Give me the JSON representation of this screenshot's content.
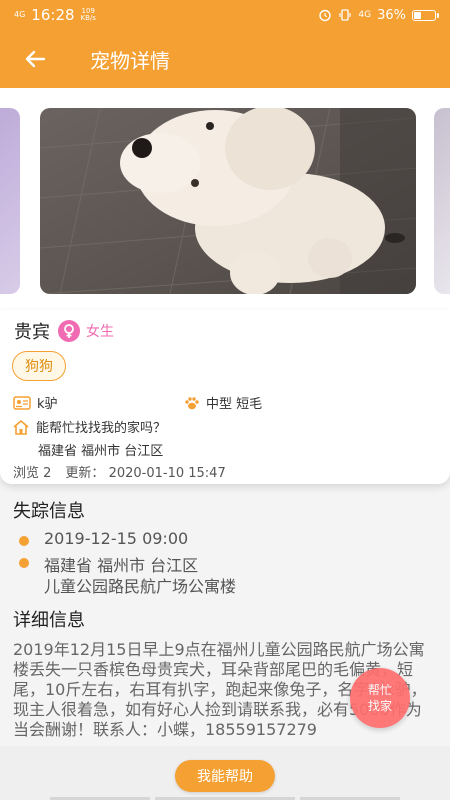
{
  "status_bar": {
    "signal": "4G",
    "time": "16:28",
    "net_speed_value": "109",
    "net_speed_unit": "KB/s",
    "network": "4G",
    "battery": "36%",
    "battery_level": 0.36
  },
  "header": {
    "back_icon": "arrow-left-icon",
    "title": "宠物详情"
  },
  "pet": {
    "name": "贵宾",
    "gender": "女生",
    "gender_icon": "female-icon",
    "category_tag": "狗狗",
    "size_label": "k驴",
    "coat_label": "中型 短毛",
    "prompt": "能帮忙找找我的家吗？",
    "region": "福建省 福州市 台江区",
    "views_label": "浏览 2",
    "updated_label": "更新：",
    "updated_time": "2020-01-10 15:47"
  },
  "lost_info": {
    "title": "失踪信息",
    "datetime": "2019-12-15 09:00",
    "region": "福建省 福州市 台江区",
    "address": "儿童公园路民航广场公寓楼"
  },
  "detail": {
    "title": "详细信息",
    "text": "2019年12月15日早上9点在福州儿童公园路民航广场公寓楼丢失一只香槟色母贵宾犬，耳朵背部尾巴的毛偏黄，短尾，10斤左右，右耳有扒字，跑起来像兔子，名字叫k驴，现主人很着急，如有好心人捡到请联系我，必有5000作为当会酬谢！联系人：小蝶，18559157279"
  },
  "floating_help": {
    "line1": "帮忙",
    "line2": "找家"
  },
  "bottom": {
    "help_button": "我能帮助"
  },
  "colors": {
    "primary": "#f5a033",
    "gender_pink": "#f06bb2",
    "help_bubble": "#ff6e6e"
  }
}
